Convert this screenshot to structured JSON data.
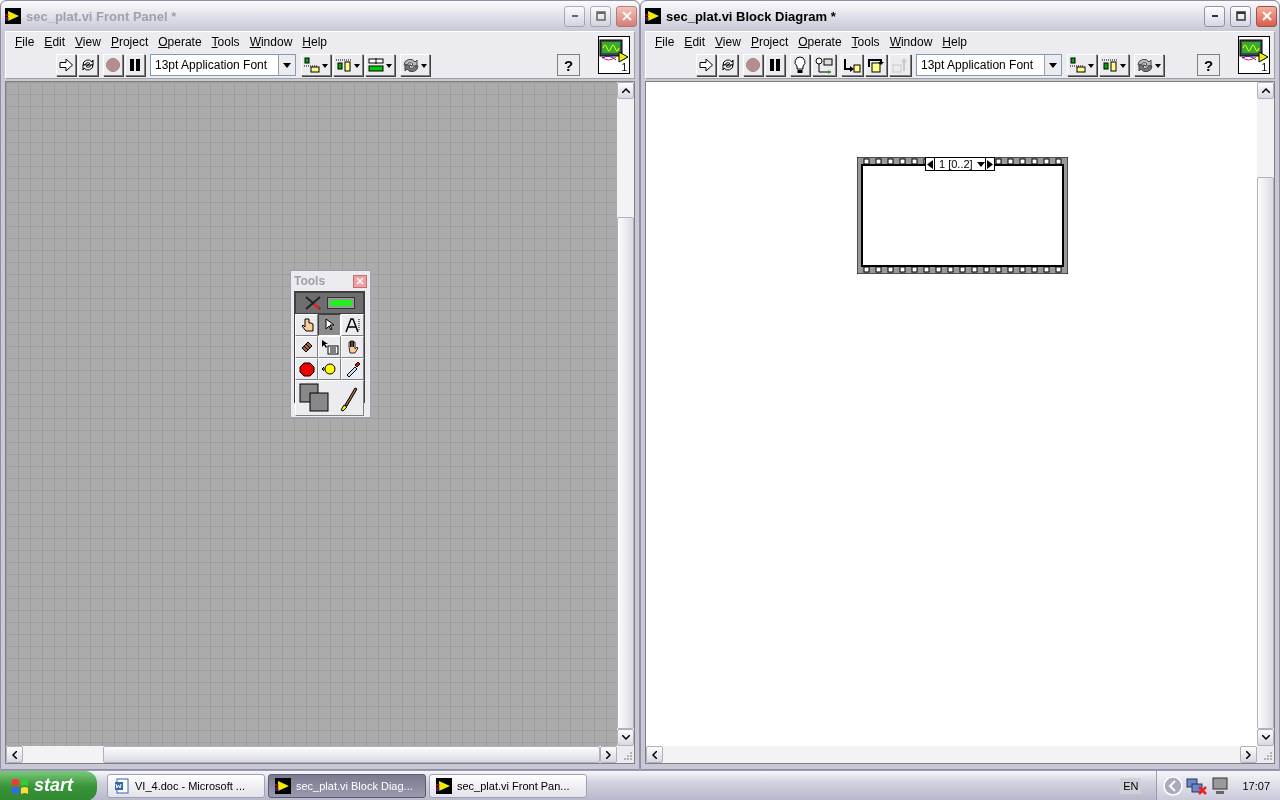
{
  "windows": [
    {
      "kind": "front-panel",
      "title": "sec_plat.vi Front Panel *",
      "active": false,
      "menu": [
        "File",
        "Edit",
        "View",
        "Project",
        "Operate",
        "Tools",
        "Window",
        "Help"
      ],
      "toolbar": [
        [
          {
            "kind": "run",
            "disabled": false
          },
          {
            "kind": "run-continuously",
            "disabled": false
          }
        ],
        [
          {
            "kind": "abort",
            "disabled": true
          },
          {
            "kind": "pause",
            "disabled": false
          }
        ],
        [
          {
            "kind": "font",
            "label": "13pt Application Font",
            "disabled": false
          }
        ],
        [
          {
            "kind": "align",
            "disabled": false
          },
          {
            "kind": "distribute",
            "disabled": false
          },
          {
            "kind": "resize",
            "disabled": false
          }
        ],
        [
          {
            "kind": "reorder",
            "disabled": false
          }
        ]
      ],
      "help": "?",
      "connector_number": "1"
    },
    {
      "kind": "block-diagram",
      "title": "sec_plat.vi Block Diagram *",
      "active": true,
      "menu": [
        "File",
        "Edit",
        "View",
        "Project",
        "Operate",
        "Tools",
        "Window",
        "Help"
      ],
      "toolbar": [
        [
          {
            "kind": "run",
            "disabled": false
          },
          {
            "kind": "run-continuously",
            "disabled": false
          }
        ],
        [
          {
            "kind": "abort",
            "disabled": true
          },
          {
            "kind": "pause",
            "disabled": false
          }
        ],
        [
          {
            "kind": "highlight",
            "disabled": false
          },
          {
            "kind": "retain",
            "disabled": false
          }
        ],
        [
          {
            "kind": "step-into",
            "disabled": false
          },
          {
            "kind": "step-over",
            "disabled": false
          },
          {
            "kind": "step-out",
            "disabled": true
          }
        ],
        [
          {
            "kind": "font",
            "label": "13pt Application Font",
            "disabled": false
          }
        ],
        [
          {
            "kind": "align",
            "disabled": false
          },
          {
            "kind": "distribute",
            "disabled": false
          }
        ],
        [
          {
            "kind": "reorder",
            "disabled": false
          }
        ]
      ],
      "help": "?",
      "connector_number": "1",
      "sequence_structure": {
        "frame_label": "1 [0..2]"
      }
    }
  ],
  "tools_palette": {
    "title": "Tools",
    "auto_tool": {
      "on": true
    },
    "tools": [
      {
        "kind": "operate",
        "selected": false
      },
      {
        "kind": "position",
        "selected": true
      },
      {
        "kind": "text",
        "selected": false
      },
      {
        "kind": "wire",
        "selected": false
      },
      {
        "kind": "shortcut-menu",
        "selected": false
      },
      {
        "kind": "scroll",
        "selected": false
      },
      {
        "kind": "breakpoint",
        "selected": false
      },
      {
        "kind": "probe",
        "selected": false
      },
      {
        "kind": "get-color",
        "selected": false
      },
      {
        "kind": "set-color",
        "selected": false
      }
    ]
  },
  "taskbar": {
    "start": "start",
    "tasks": [
      {
        "kind": "word",
        "label": "VI_4.doc - Microsoft ...",
        "selected": false
      },
      {
        "kind": "labview",
        "label": "sec_plat.vi Block Diag...",
        "selected": true
      },
      {
        "kind": "labview",
        "label": "sec_plat.vi Front Pan...",
        "selected": false
      }
    ],
    "language": "EN",
    "clock": "17:07"
  }
}
